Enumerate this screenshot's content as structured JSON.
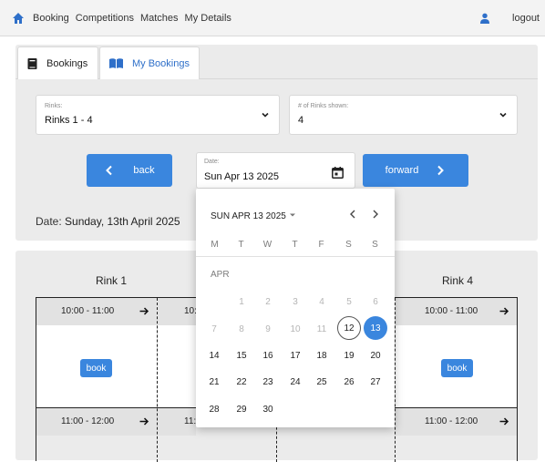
{
  "nav": {
    "items": [
      "Booking",
      "Competitions",
      "Matches",
      "My Details"
    ],
    "logout": "logout"
  },
  "tabs": {
    "bookings": "Bookings",
    "my_bookings": "My Bookings"
  },
  "rinks_select": {
    "label": "Rinks:",
    "value": "Rinks 1 - 4"
  },
  "shown_select": {
    "label": "# of Rinks shown:",
    "value": "4"
  },
  "controls": {
    "back": "back",
    "forward": "forward",
    "date_label": "Date:",
    "date_value": "Sun Apr 13 2025"
  },
  "date_line": {
    "key": "Date:",
    "value": "Sunday, 13th April 2025"
  },
  "rinks": {
    "rink1": "Rink 1",
    "rink4": "Rink 4"
  },
  "slots": {
    "slot1": "10:00 - 11:00",
    "slot2": "11:00 - 12:00",
    "slot1_partial": "10:",
    "slot2_partial": "11:",
    "book": "book"
  },
  "calendar": {
    "header": "SUN APR 13 2025",
    "month_label": "APR",
    "weekdays": [
      "M",
      "T",
      "W",
      "T",
      "F",
      "S",
      "S"
    ],
    "week1": [
      "1",
      "2",
      "3",
      "4",
      "5",
      "6"
    ],
    "week2": [
      "7",
      "8",
      "9",
      "10",
      "11",
      "12",
      "13"
    ],
    "week3": [
      "14",
      "15",
      "16",
      "17",
      "18",
      "19",
      "20"
    ],
    "week4": [
      "21",
      "22",
      "23",
      "24",
      "25",
      "26",
      "27"
    ],
    "week5": [
      "28",
      "29",
      "30"
    ]
  },
  "colors": {
    "accent": "#3a86de",
    "panel": "#ebebeb",
    "navbar": "#f3f3f3"
  }
}
